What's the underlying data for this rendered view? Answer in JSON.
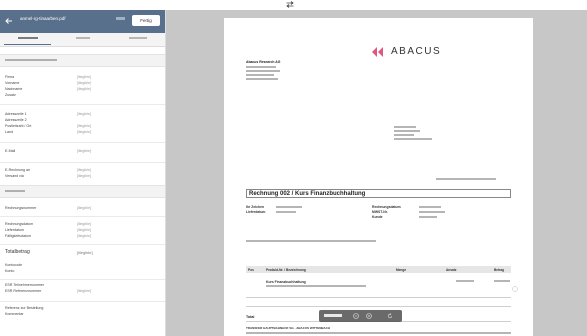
{
  "header": {
    "file_name": "anmel-rg-tinaarben.pdf",
    "done_label": "Fertig"
  },
  "form": {
    "contact_labels": [
      "Firma",
      "Vorname",
      "Nachname",
      "Zusatz"
    ],
    "address_labels": [
      "Adresszeile 1",
      "Adresszeile 2",
      "Postleitzahl / Ort",
      "Land"
    ],
    "email_label": "E-Mail",
    "billing_labels": [
      "E-Rechnung an",
      "Versand via"
    ],
    "date_labels": [
      "Rechnungsnummer",
      "Rechnungsdatum",
      "Lieferdatum",
      "Fälligkeitsdatum"
    ],
    "total_label": "Totalbetrag",
    "bank_labels": [
      "Kontocode",
      "Konto",
      "ESR Teilnehmernummer",
      "ESR Referenznummer"
    ],
    "reference_label": "Referenz zur Bestellung",
    "comment_label": "Kommentar",
    "unreadable_value": "[illegible]"
  },
  "document": {
    "logo_text": "ABACUS",
    "sender_name": "Abacus Research AG",
    "invoice_title": "Rechnung 002 / Kurs Finanzbuchhaltung",
    "meta_labels": [
      "Ihr Zeichen",
      "Lieferdatum",
      "Rechnungsdatum",
      "MWST-Nr.",
      "Kunde"
    ],
    "table_headers": [
      "Pos",
      "Produkt-Nr. / Bezeichnung",
      "Menge",
      "Ansatz",
      "Betrag"
    ],
    "line_item": "Kurs Finanzbuchhaltung",
    "total_label": "Total",
    "transfer_heading": "TRANSFER HAUPTBAHNHOF SG - ABACUS WITTENBACH"
  },
  "icons": {
    "swap": "swap-arrows-icon",
    "back": "arrow-left-icon",
    "logo": "abacus-logo-icon",
    "zoom_out": "zoom-out-icon",
    "zoom_in": "zoom-in-icon",
    "rotate": "rotate-icon",
    "side": "circle-icon"
  },
  "colors": {
    "header": "#58708b",
    "viewer_background": "#c7c7c7",
    "logo": "#e0577f"
  }
}
